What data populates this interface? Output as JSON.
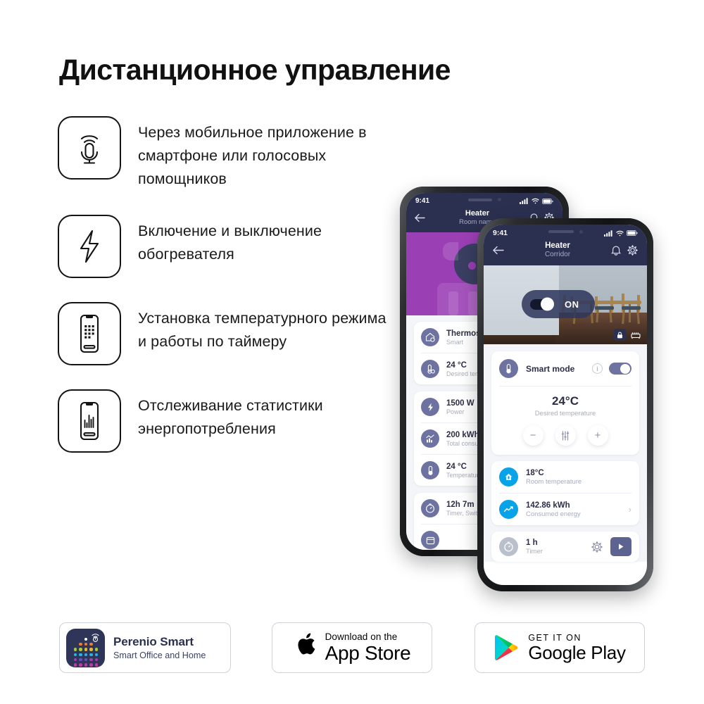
{
  "page": {
    "title": "Дистанционное управление",
    "background": "#ffffff"
  },
  "features": [
    {
      "icon": "microphone-voice-icon",
      "text": "Через мобильное приложение в смартфоне или голосовых помощников"
    },
    {
      "icon": "lightning-bolt-icon",
      "text": "Включение и выключение обогревателя"
    },
    {
      "icon": "phone-keypad-icon",
      "text": "Установка температурного режима и работы по таймеру"
    },
    {
      "icon": "phone-statistics-icon",
      "text": "Отслеживание статистики энергопотребления"
    }
  ],
  "back_phone": {
    "statusbar": {
      "time": "9:41"
    },
    "navbar": {
      "title": "Heater",
      "subtitle": "Room name",
      "back": "←",
      "bell": "bell-icon",
      "gear": "gear-icon"
    },
    "hero": {
      "color": "#9b3fb5"
    },
    "list": [
      {
        "value": "Thermostat",
        "label": "Smart",
        "icon": "thermostat-smart-icon"
      },
      {
        "value": "24 °C",
        "label": "Desired temperature",
        "icon": "thermometer-set-icon"
      },
      {
        "value": "1500 W",
        "label": "Power",
        "icon": "bolt-icon"
      },
      {
        "value": "200 kWh",
        "label": "Total consumption",
        "icon": "chart-icon"
      },
      {
        "value": "24 °C",
        "label": "Temperature",
        "icon": "thermometer-icon"
      },
      {
        "value": "12h 7m",
        "label": "Timer, Switch",
        "icon": "timer-icon"
      }
    ]
  },
  "front_phone": {
    "statusbar": {
      "time": "9:41",
      "signal": "signal-icon",
      "wifi": "wifi-icon",
      "battery": "battery-icon"
    },
    "navbar": {
      "title": "Heater",
      "subtitle": "Corridor",
      "back": "←",
      "bell": "bell-icon",
      "gear": "gear-icon"
    },
    "hero": {
      "toggle_label": "ON",
      "toggle_state": "on",
      "lock": "lock-icon",
      "furniture": "furniture-icon"
    },
    "smart_mode": {
      "label": "Smart mode",
      "icon": "thermometer-icon",
      "info": "info-icon",
      "toggle_state": "on",
      "temperature": "24°C",
      "temperature_label": "Desired temperature",
      "minus": "−",
      "sliders": "sliders-icon",
      "plus": "+"
    },
    "stats": [
      {
        "value": "18°C",
        "label": "Room temperature",
        "icon": "home-temp-icon",
        "color": "#06a3e8"
      },
      {
        "value": "142.86 kWh",
        "label": "Consumed energy",
        "icon": "energy-chart-icon",
        "color": "#06a3e8",
        "chevron": "›"
      }
    ],
    "timer": {
      "value": "1 h",
      "label": "Timer",
      "icon": "timer-icon",
      "gear": "gear-icon",
      "play": "play-icon"
    }
  },
  "footer": {
    "perenio": {
      "name": "Perenio Smart",
      "tagline": "Smart Office and Home",
      "icon": "perenio-app-icon"
    },
    "appstore": {
      "small": "Download on the",
      "big": "App Store",
      "icon": "apple-logo-icon"
    },
    "googleplay": {
      "small": "GET IT ON",
      "big": "Google Play",
      "icon": "google-play-icon"
    }
  }
}
